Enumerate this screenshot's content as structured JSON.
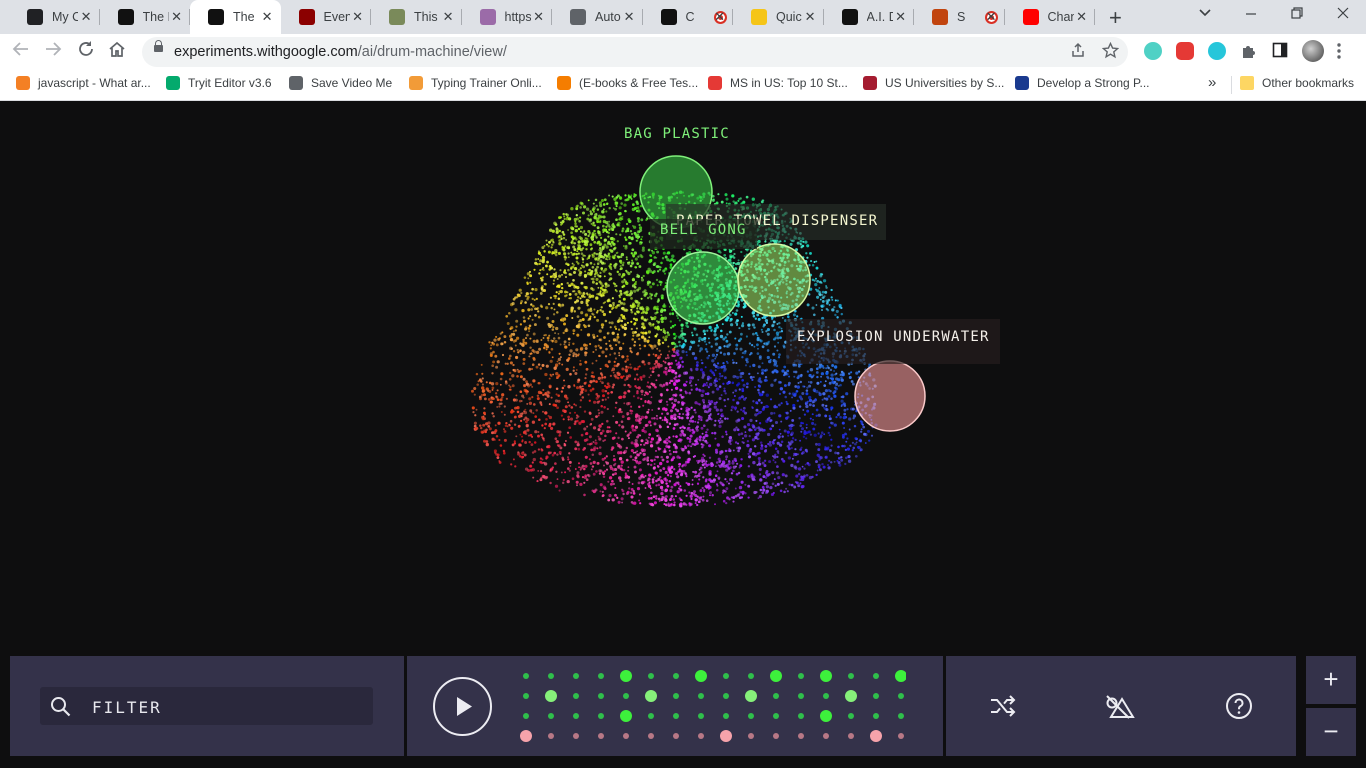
{
  "browser": {
    "tabs": [
      {
        "title": "My C",
        "fav": "spark-icon",
        "color": "#202124"
      },
      {
        "title": "The I",
        "fav": "e-icon",
        "color": "#111111"
      },
      {
        "title": "The I",
        "fav": "openai-icon",
        "color": "#111111",
        "active": true
      },
      {
        "title": "Even",
        "fav": "hat-icon",
        "color": "#8b0000"
      },
      {
        "title": "This I",
        "fav": "photo-icon",
        "color": "#7a8a5a"
      },
      {
        "title": "https",
        "fav": "avatar-icon",
        "color": "#9b6ba8"
      },
      {
        "title": "Auto",
        "fav": "pen-icon",
        "color": "#5f6368"
      },
      {
        "title": "C",
        "fav": "mask-icon",
        "color": "#111111",
        "recording": true
      },
      {
        "title": "Quic",
        "fav": "bolt-icon",
        "color": "#f5c518"
      },
      {
        "title": "A.I. D",
        "fav": "piano-icon",
        "color": "#111111"
      },
      {
        "title": "S",
        "fav": "bug-icon",
        "color": "#c1440e",
        "recording": true
      },
      {
        "title": "Chan",
        "fav": "youtube-icon",
        "color": "#ff0000"
      }
    ],
    "url_domain": "experiments.withgoogle.com",
    "url_path": "/ai/drum-machine/view/",
    "bookmarks": [
      {
        "label": "javascript - What ar...",
        "color": "#f48024"
      },
      {
        "label": "Tryit Editor v3.6",
        "color": "#04aa6d"
      },
      {
        "label": "Save Video Me",
        "color": "#5f6368"
      },
      {
        "label": "Typing Trainer Onli...",
        "color": "#f29b38"
      },
      {
        "label": "(E-books & Free Tes...",
        "color": "#f57d00"
      },
      {
        "label": "MS in US: Top 10 St...",
        "color": "#e53935"
      },
      {
        "label": "US Universities by S...",
        "color": "#a51c30"
      },
      {
        "label": "Develop a Strong P...",
        "color": "#1a3a8f"
      }
    ],
    "bookmarks_overflow": "»",
    "other_bookmarks": "Other bookmarks"
  },
  "map": {
    "labels": [
      {
        "text": "BAG PLASTIC",
        "color": "#7ff07a"
      },
      {
        "text": "PAPER TOWEL DISPENSER",
        "color": "#f3f5cf"
      },
      {
        "text": "BELL GONG",
        "color": "#7ff07a"
      },
      {
        "text": "EXPLOSION UNDERWATER",
        "color": "#f5f0ea"
      }
    ],
    "selections": [
      {
        "name": "bag-plastic-selection",
        "color": "#3dd64a"
      },
      {
        "name": "bell-gong-selection",
        "color": "#45e05a"
      },
      {
        "name": "paper-towel-selection",
        "color": "#a6ee6a"
      },
      {
        "name": "explosion-selection",
        "color": "#f59a9a"
      }
    ]
  },
  "controls": {
    "filter_placeholder": "FILTER",
    "sequencer": {
      "steps": 16,
      "rows": [
        {
          "color": "#2fbf4b",
          "active_color": "#3df03c",
          "active": [
            4,
            7,
            10,
            12,
            15
          ]
        },
        {
          "color": "#2fbf4b",
          "active_color": "#86f07a",
          "active": [
            1,
            5,
            9,
            13
          ]
        },
        {
          "color": "#2fbf4b",
          "active_color": "#3df03c",
          "active": [
            4,
            12
          ]
        },
        {
          "color": "#b87886",
          "active_color": "#f7a3ab",
          "active": [
            0,
            8,
            14
          ]
        }
      ]
    },
    "zoom_in": "+",
    "zoom_out": "−"
  }
}
